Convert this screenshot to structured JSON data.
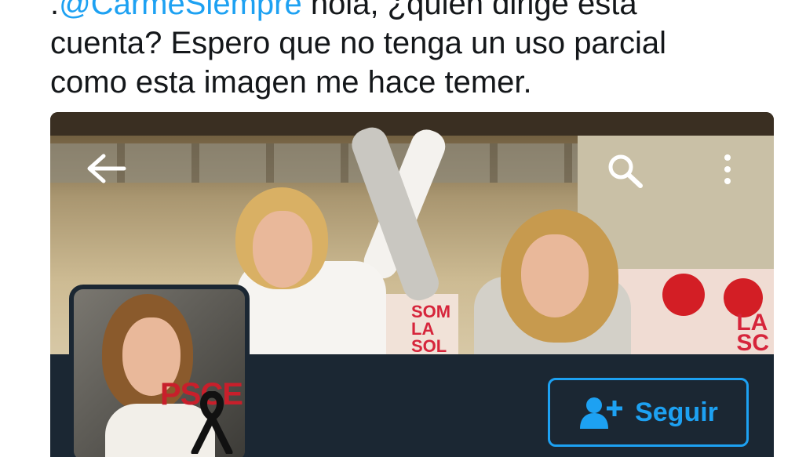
{
  "tweet": {
    "mention": "@CarmeSiempre",
    "text_line1_rest": " hola, ¿quién dirige esta",
    "text_line1_prefix": ".",
    "text_line2": "cuenta? Espero que no tenga un uso parcial",
    "text_line3": "como esta imagen me hace temer."
  },
  "profile": {
    "follow_label": "Seguir",
    "avatar_text": "PSCE",
    "banner_sign_1": "SOM\nLA\nSOL",
    "banner_sign_2": "LA\nSC"
  },
  "icons": {
    "back": "arrow-left-icon",
    "search": "search-icon",
    "more": "more-vertical-icon",
    "follow": "add-user-icon"
  },
  "colors": {
    "accent": "#1da1f2",
    "profile_background": "#1b2733",
    "text": "#14171a"
  }
}
